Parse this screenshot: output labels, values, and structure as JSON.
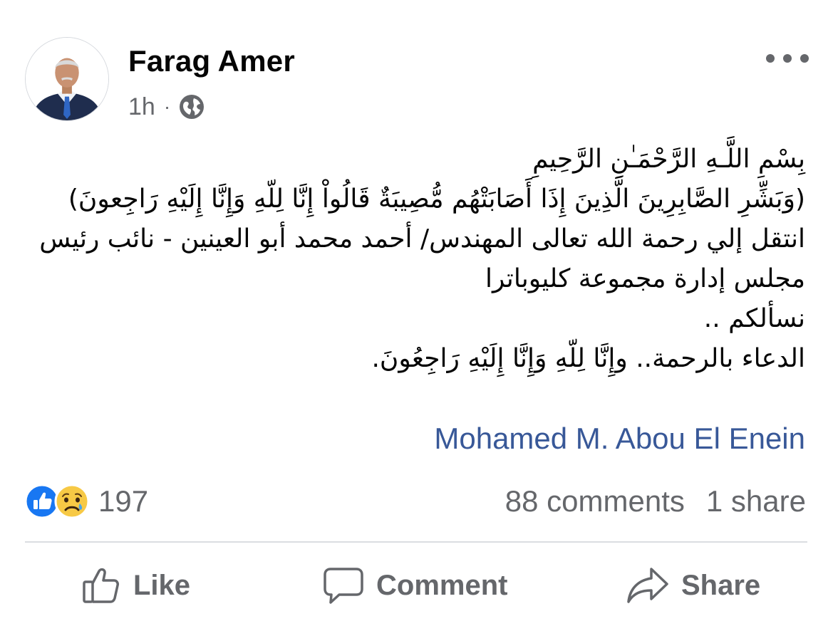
{
  "post": {
    "author": "Farag Amer",
    "time": "1h",
    "separator": "·",
    "audience_icon": "globe-icon",
    "body_lines": [
      "بِسْمِ اللَّـهِ الرَّحْمَـٰنِ الرَّحِيمِ",
      "(وَبَشِّرِ الصَّابِرِينَ الَّذِينَ إِذَا أَصَابَتْهُم مُّصِيبَةٌ قَالُواْ إِنَّا لِلّهِ وَإِنَّا إِلَيْهِ رَاجِعونَ)",
      "انتقل إلي رحمة الله تعالى المهندس/ أحمد محمد أبو العينين - نائب رئيس مجلس إدارة مجموعة كليوباترا",
      "نسألكم ..",
      "الدعاء بالرحمة.. وإِنَّا لِلّهِ وَإِنَّا إِلَيْهِ رَاجِعُونَ."
    ],
    "mention": "Mohamed M. Abou El Enein"
  },
  "reactions": {
    "icons": [
      "like-reaction-icon",
      "sad-reaction-icon"
    ],
    "count": "197",
    "comments": "88 comments",
    "shares": "1 share"
  },
  "actions": {
    "like": "Like",
    "comment": "Comment",
    "share": "Share"
  },
  "colors": {
    "primary_text": "#050505",
    "secondary_text": "#65676b",
    "link": "#385898",
    "like_blue": "#1877f2",
    "sad_yellow": "#f7c945",
    "divider": "#dadde1"
  }
}
